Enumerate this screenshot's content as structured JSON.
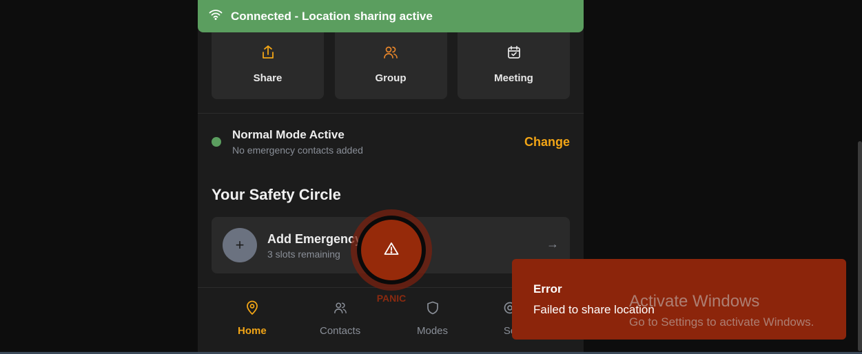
{
  "banner": {
    "text": "Connected - Location sharing active",
    "icon": "wifi-icon",
    "color": "#5b9e5f"
  },
  "quick_actions": [
    {
      "label": "Share",
      "icon": "share-icon"
    },
    {
      "label": "Group",
      "icon": "users-icon"
    },
    {
      "label": "Meeting",
      "icon": "calendar-check-icon"
    }
  ],
  "mode": {
    "title": "Normal Mode Active",
    "subtitle": "No emergency contacts added",
    "change_label": "Change",
    "status_color": "#5b9e5f"
  },
  "safety_circle": {
    "heading": "Your Safety Circle",
    "add_card": {
      "plus": "+",
      "title": "Add Emergency",
      "subtitle": "3 slots remaining",
      "arrow": "→"
    }
  },
  "panic": {
    "label": "PANIC",
    "icon": "warning-icon",
    "color": "#962a0a"
  },
  "nav": [
    {
      "label": "Home",
      "icon": "map-pin-icon",
      "active": true
    },
    {
      "label": "Contacts",
      "icon": "users-icon",
      "active": false
    },
    {
      "label": "Modes",
      "icon": "shield-icon",
      "active": false
    },
    {
      "label": "Se",
      "icon": "settings-icon",
      "active": false
    }
  ],
  "toast": {
    "title": "Error",
    "message": "Failed to share location",
    "color": "#8c250b"
  },
  "watermark": {
    "line1": "Activate Windows",
    "line2": "Go to Settings to activate Windows."
  },
  "colors": {
    "accent": "#f2a516",
    "background": "#1c1c1c",
    "card": "#2a2a2a"
  }
}
